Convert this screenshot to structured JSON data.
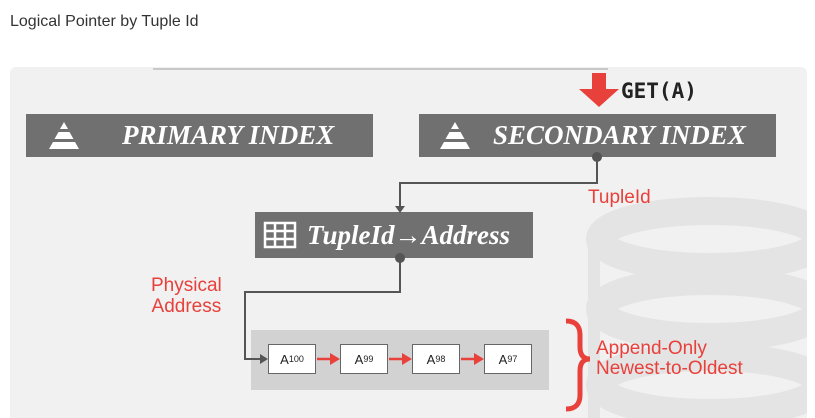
{
  "page": {
    "title": "Logical Pointer by Tuple Id"
  },
  "diagram": {
    "primary_index_label": "PRIMARY INDEX",
    "secondary_index_label": "SECONDARY INDEX",
    "request_label": "GET(A)",
    "tupleid_label": "TupleId",
    "mapping_label": "TupleId→Address",
    "physical_address_label_line1": "Physical",
    "physical_address_label_line2": "Address",
    "version_chain": [
      {
        "base": "A",
        "sub": "100"
      },
      {
        "base": "A",
        "sub": "99"
      },
      {
        "base": "A",
        "sub": "98"
      },
      {
        "base": "A",
        "sub": "97"
      }
    ],
    "chain_note_line1": "Append-Only",
    "chain_note_line2": "Newest-to-Oldest",
    "colors": {
      "accent_red": "#e8403b",
      "box_gray": "#707070",
      "background": "#f1f1f1"
    },
    "icons": [
      "pyramid-icon",
      "down-arrow-icon",
      "table-icon",
      "database-cylinder-icon",
      "right-brace-icon"
    ]
  }
}
